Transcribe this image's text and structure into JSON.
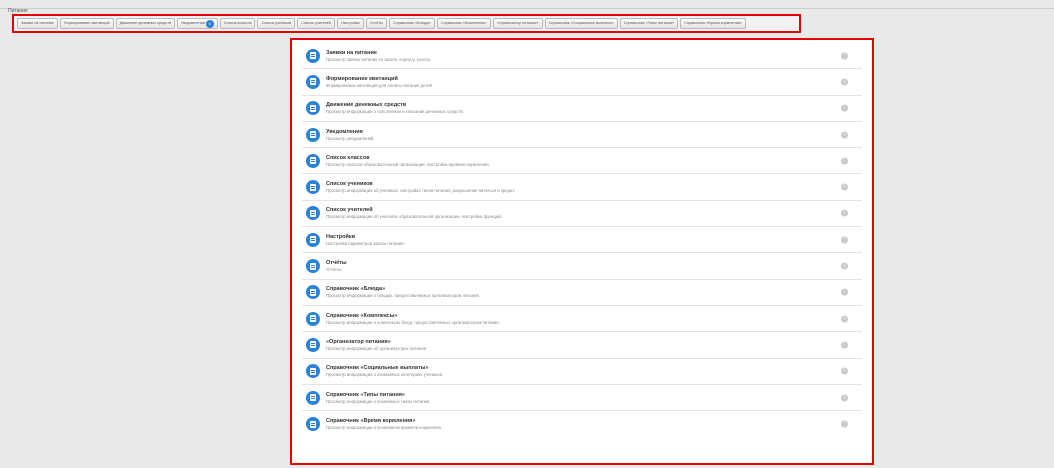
{
  "page_label": "Питание",
  "tabs": [
    {
      "label": "Заявки на питание"
    },
    {
      "label": "Формирование квитанций"
    },
    {
      "label": "Движение денежных средств"
    },
    {
      "label": "Уведомления",
      "badge": "0"
    },
    {
      "label": "Список классов"
    },
    {
      "label": "Список учеников"
    },
    {
      "label": "Список учителей"
    },
    {
      "label": "Настройки"
    },
    {
      "label": "Отчёты"
    },
    {
      "label": "Справочник «Блюда»"
    },
    {
      "label": "Справочник «Комплексы»"
    },
    {
      "label": "«Организатор питания»"
    },
    {
      "label": "Справочник «Социальные выплаты»"
    },
    {
      "label": "Справочник «Типы питания»"
    },
    {
      "label": "Справочник «Время кормления»"
    }
  ],
  "menu": [
    {
      "title": "Заявки на питание",
      "desc": "Просмотр заявок питания по школе, корпусу, классу."
    },
    {
      "title": "Формирование квитанций",
      "desc": "Формирование квитанций для оплаты питания детей."
    },
    {
      "title": "Движение денежных средств",
      "desc": "Просмотр информации о пополнении и списании денежных средств."
    },
    {
      "title": "Уведомления",
      "desc": "Просмотр уведомлений."
    },
    {
      "title": "Список классов",
      "desc": "Просмотр классов образовательной организации, настройка времени кормления."
    },
    {
      "title": "Список учеников",
      "desc": "Просмотр информации об учениках, настройка типов питания, разрешение питаться в кредит."
    },
    {
      "title": "Список учителей",
      "desc": "Просмотр информации об учителях образовательной организации, настройка функций."
    },
    {
      "title": "Настройки",
      "desc": "Настройки параметров заказа питания."
    },
    {
      "title": "Отчёты",
      "desc": "Отчёты."
    },
    {
      "title": "Справочник «Блюда»",
      "desc": "Просмотр информации о блюдах, предоставляемых организатором питания."
    },
    {
      "title": "Справочник «Комплексы»",
      "desc": "Просмотр информации о комплексах блюд, предоставляемых организатором питания."
    },
    {
      "title": "«Организатор питания»",
      "desc": "Просмотр информации об организаторах питания."
    },
    {
      "title": "Справочник «Социальные выплаты»",
      "desc": "Просмотр информации о возможных категориях учеников."
    },
    {
      "title": "Справочник «Типы питания»",
      "desc": "Просмотр информации о возможных типах питания."
    },
    {
      "title": "Справочник «Время кормления»",
      "desc": "Просмотр информации о возможном времени кормления."
    }
  ],
  "colors": {
    "accent": "#2b82d9",
    "highlight": "#e60000"
  }
}
